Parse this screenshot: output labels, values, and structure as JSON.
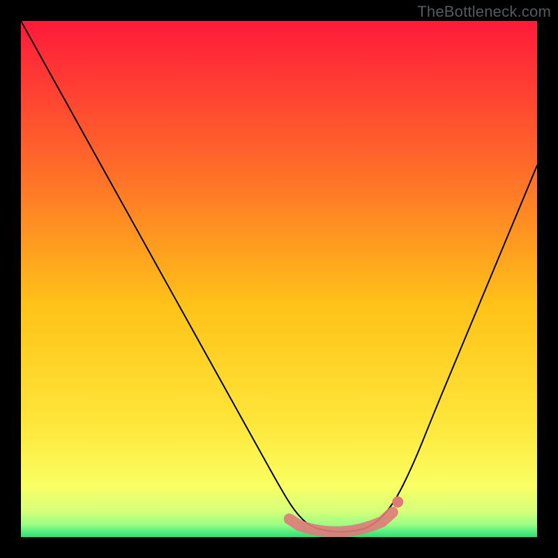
{
  "watermark": "TheBottleneck.com",
  "chart_data": {
    "type": "line",
    "title": "",
    "xlabel": "",
    "ylabel": "",
    "xlim": [
      0,
      100
    ],
    "ylim": [
      0,
      100
    ],
    "grid": false,
    "annotations": [],
    "background_gradient": {
      "stops": [
        {
          "offset": 0.0,
          "color": "#ff1a3a"
        },
        {
          "offset": 0.28,
          "color": "#ff6a2a"
        },
        {
          "offset": 0.55,
          "color": "#ffc218"
        },
        {
          "offset": 0.78,
          "color": "#ffe63a"
        },
        {
          "offset": 0.9,
          "color": "#f9ff62"
        },
        {
          "offset": 0.95,
          "color": "#d6ff7a"
        },
        {
          "offset": 0.975,
          "color": "#9dff84"
        },
        {
          "offset": 1.0,
          "color": "#28e07a"
        }
      ]
    },
    "series": [
      {
        "name": "bottleneck-curve",
        "color": "#000000",
        "x": [
          0,
          5,
          10,
          15,
          20,
          25,
          30,
          35,
          40,
          45,
          50,
          53,
          56,
          60,
          64,
          68,
          72,
          76,
          80,
          85,
          90,
          95,
          100
        ],
        "y": [
          100,
          91,
          82,
          73,
          64,
          55,
          46,
          37,
          28,
          19,
          10,
          5,
          2,
          1,
          1,
          2,
          6,
          14,
          24,
          36,
          48,
          60,
          72
        ]
      }
    ],
    "markers": {
      "name": "optimal-zone",
      "color": "#e07a7a",
      "radius": 1.2,
      "x": [
        52,
        54,
        56,
        58,
        60,
        62,
        64,
        66,
        68,
        70,
        72
      ],
      "y": [
        3.5,
        2.2,
        1.6,
        1.2,
        1.0,
        1.0,
        1.2,
        1.6,
        2.2,
        3.0,
        4.8
      ]
    }
  }
}
